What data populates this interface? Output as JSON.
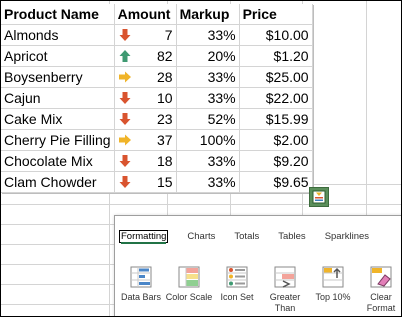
{
  "headers": {
    "product": "Product Name",
    "amount": "Amount",
    "markup": "Markup",
    "price": "Price"
  },
  "rows": [
    {
      "product": "Almonds",
      "arrow": "down-red",
      "amount": "7",
      "markup": "33%",
      "price": "$10.00"
    },
    {
      "product": "Apricot",
      "arrow": "up-green",
      "amount": "82",
      "markup": "20%",
      "price": "$1.20"
    },
    {
      "product": "Boysenberry",
      "arrow": "right-yellow",
      "amount": "28",
      "markup": "33%",
      "price": "$25.00"
    },
    {
      "product": "Cajun",
      "arrow": "down-red",
      "amount": "10",
      "markup": "33%",
      "price": "$22.00"
    },
    {
      "product": "Cake Mix",
      "arrow": "down-red",
      "amount": "23",
      "markup": "52%",
      "price": "$15.99"
    },
    {
      "product": "Cherry Pie Filling",
      "arrow": "right-yellow",
      "amount": "37",
      "markup": "100%",
      "price": "$2.00"
    },
    {
      "product": "Chocolate  Mix",
      "arrow": "down-red",
      "amount": "18",
      "markup": "33%",
      "price": "$9.20"
    },
    {
      "product": "Clam Chowder",
      "arrow": "down-red",
      "amount": "15",
      "markup": "33%",
      "price": "$9.65"
    }
  ],
  "colors": {
    "down": "#d9542f",
    "up": "#3f9a72",
    "right": "#f0b429",
    "accent": "#217346"
  },
  "quick_analysis": {
    "icon": "quick-analysis-icon",
    "tabs": [
      "Formatting",
      "Charts",
      "Totals",
      "Tables",
      "Sparklines"
    ],
    "active_tab": "Formatting",
    "tools": [
      {
        "label": "Data Bars",
        "icon": "data-bars-icon"
      },
      {
        "label": "Color Scale",
        "icon": "color-scale-icon"
      },
      {
        "label": "Icon Set",
        "icon": "icon-set-icon"
      },
      {
        "label": "Greater Than",
        "icon": "greater-than-icon"
      },
      {
        "label": "Top 10%",
        "icon": "top-10-icon"
      },
      {
        "label": "Clear Format",
        "icon": "clear-format-icon"
      }
    ]
  }
}
